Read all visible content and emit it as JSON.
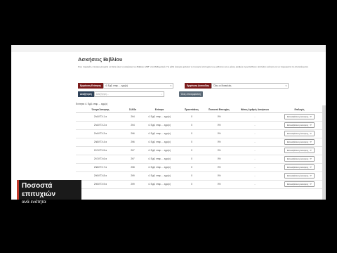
{
  "page": {
    "title": "Ασκήσεις Βιβλίου",
    "description": "Στον παρακάτω πίνακα μπορείτε να δείτε όλες τις ασκήσεις του Βιβλίου Α/Β/Γ στα Μαθηματικά. Για κάθε άσκηση φαίνεται το ποσοστό επιτυχίας των μαθητών και ο μέσος αριθμός προσπαθειών. Επιλέξτε ενότητα για να περιορίσετε τα αποτελέσματα."
  },
  "filters": {
    "section_label": "Εμφάνιση Ενότητας",
    "section_value": "4. Εμβ. επιφ. ... ερμ(ο)",
    "difficulty_label": "Εμφάνιση Δυσκολίας",
    "difficulty_value": "Όλες οι δυσκολίες",
    "search_label": "Αναζήτηση",
    "search_placeholder": "Αναζήτηση...",
    "show_button": "Όλες επανεμφάνιση"
  },
  "active_filter_chip": "Ενότητα: 4. Εμβ. επιφ. ... ερμ(ο)",
  "table": {
    "columns": [
      "Όνομα Άσκησης",
      "Σελίδα",
      "Ενότητα",
      "Προσπάθειες",
      "Ποσοστό Επιτυχίας",
      "Μέσος Αριθμός Ασκήσεων",
      "Επιλογές"
    ],
    "rows": [
      {
        "name": "2h4-ΚΤΧ-1.α",
        "page": "2h4",
        "section": "4. Εμβ. επιφ. ... ερμ(ο)",
        "attempts": "0",
        "success": "0%",
        "avg": "-",
        "action": "Επανεξέταση άσκησης"
      },
      {
        "name": "2h4-ΚΤΧ-2.α",
        "page": "2h4",
        "section": "4. Εμβ. επιφ. ... ερμ(ο)",
        "attempts": "0",
        "success": "0%",
        "avg": "-",
        "action": "Επανεξέταση άσκησης"
      },
      {
        "name": "2h4-ΚΤΧ-3.α",
        "page": "2h6",
        "section": "4. Εμβ. επιφ. ... ερμ(ο)",
        "attempts": "0",
        "success": "0%",
        "avg": "-",
        "action": "Επανεξέταση άσκησης"
      },
      {
        "name": "2h8-ΚΤΧ-4.α",
        "page": "2h6",
        "section": "4. Εμβ. επιφ. ... ερμ(ο)",
        "attempts": "0",
        "success": "0%",
        "avg": "-",
        "action": "Επανεξέταση άσκησης"
      },
      {
        "name": "2h7-ΚΤΧ-5.α",
        "page": "2h7",
        "section": "4. Εμβ. επιφ. ... ερμ(ο)",
        "attempts": "0",
        "success": "0%",
        "avg": "-",
        "action": "Επανεξέταση άσκησης"
      },
      {
        "name": "2h7-ΚΤΧ-6.α",
        "page": "2h7",
        "section": "4. Εμβ. επιφ. ... ερμ(ο)",
        "attempts": "0",
        "success": "0%",
        "avg": "-",
        "action": "Επανεξέταση άσκησης"
      },
      {
        "name": "2h8-ΚΤΧ-7.α",
        "page": "2h8",
        "section": "4. Εμβ. επιφ. ... ερμ(ο)",
        "attempts": "0",
        "success": "0%",
        "avg": "-",
        "action": "Επανεξέταση άσκησης"
      },
      {
        "name": "2h9-ΚΤΧ-8.α",
        "page": "2h9",
        "section": "4. Εμβ. επιφ. ... ερμ(ο)",
        "attempts": "0",
        "success": "0%",
        "avg": "-",
        "action": "Επανεξέταση άσκησης"
      },
      {
        "name": "2h9-ΚΤΧ-9.α",
        "page": "2h9",
        "section": "4. Εμβ. επιφ. ... ερμ(ο)",
        "attempts": "0",
        "success": "0%",
        "avg": "-",
        "action": "Επανεξέταση άσκησης"
      }
    ]
  },
  "banner": {
    "title": "Ποσοστά επιτυχιών",
    "subtitle": "ανά ενότητα"
  },
  "colors": {
    "accent_red": "#7b1c1c",
    "search_blue": "#2f4259",
    "banner_bar": "#c0392b"
  }
}
